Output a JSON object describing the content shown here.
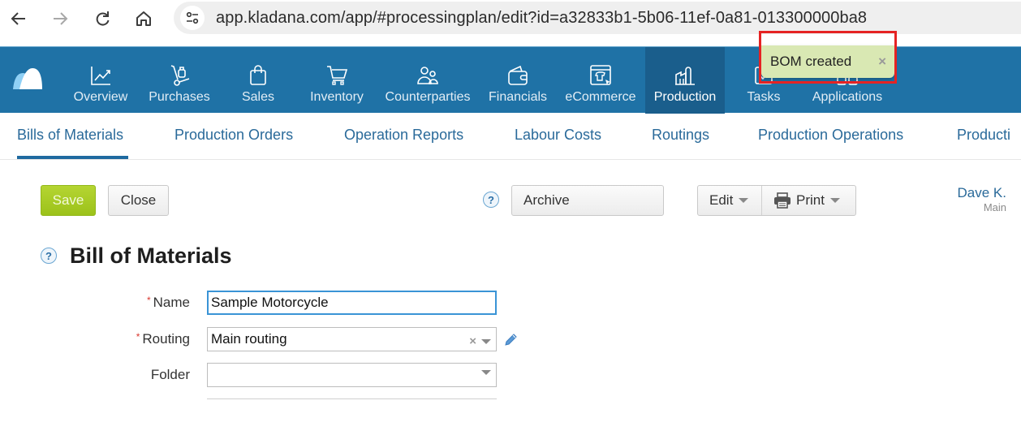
{
  "browser": {
    "url": "app.kladana.com/app/#processingplan/edit?id=a32833b1-5b06-11ef-0a81-013300000ba8",
    "back_icon": "arrow-left-icon",
    "forward_icon": "arrow-right-icon",
    "reload_icon": "reload-icon",
    "home_icon": "home-icon",
    "site_info_icon": "tune-icon"
  },
  "topnav": {
    "items": [
      {
        "label": "Overview",
        "icon": "chart-line-icon",
        "active": false
      },
      {
        "label": "Purchases",
        "icon": "hand-truck-icon",
        "active": false
      },
      {
        "label": "Sales",
        "icon": "shopping-bag-icon",
        "active": false
      },
      {
        "label": "Inventory",
        "icon": "cart-icon",
        "active": false
      },
      {
        "label": "Counterparties",
        "icon": "people-icon",
        "active": false
      },
      {
        "label": "Financials",
        "icon": "wallet-icon",
        "active": false
      },
      {
        "label": "eCommerce",
        "icon": "storefront-icon",
        "active": false
      },
      {
        "label": "Production",
        "icon": "factory-icon",
        "active": true
      },
      {
        "label": "Tasks",
        "icon": "checkbox-icon",
        "active": false
      },
      {
        "label": "Applications",
        "icon": "apps-icon",
        "active": false
      }
    ],
    "colors": {
      "background": "#1f72a6",
      "active": "#1a5e8c"
    }
  },
  "toast": {
    "message": "BOM created",
    "close": "×"
  },
  "subtabs": {
    "items": [
      {
        "label": "Bills of Materials",
        "active": true
      },
      {
        "label": "Production Orders",
        "active": false
      },
      {
        "label": "Operation Reports",
        "active": false
      },
      {
        "label": "Labour Costs",
        "active": false
      },
      {
        "label": "Routings",
        "active": false
      },
      {
        "label": "Production Operations",
        "active": false
      },
      {
        "label": "Producti",
        "active": false
      }
    ]
  },
  "toolbar": {
    "save_label": "Save",
    "close_label": "Close",
    "help": "?",
    "archive_label": "Archive",
    "edit_label": "Edit",
    "print_label": "Print"
  },
  "user": {
    "name": "Dave K.",
    "org": "Main"
  },
  "page": {
    "title": "Bill of Materials",
    "help": "?"
  },
  "form": {
    "required_mark": "*",
    "name": {
      "label": "Name",
      "value": "Sample Motorcycle",
      "required": true
    },
    "routing": {
      "label": "Routing",
      "value": "Main routing",
      "required": true,
      "clear": "×"
    },
    "folder": {
      "label": "Folder",
      "value": "",
      "required": false
    }
  }
}
